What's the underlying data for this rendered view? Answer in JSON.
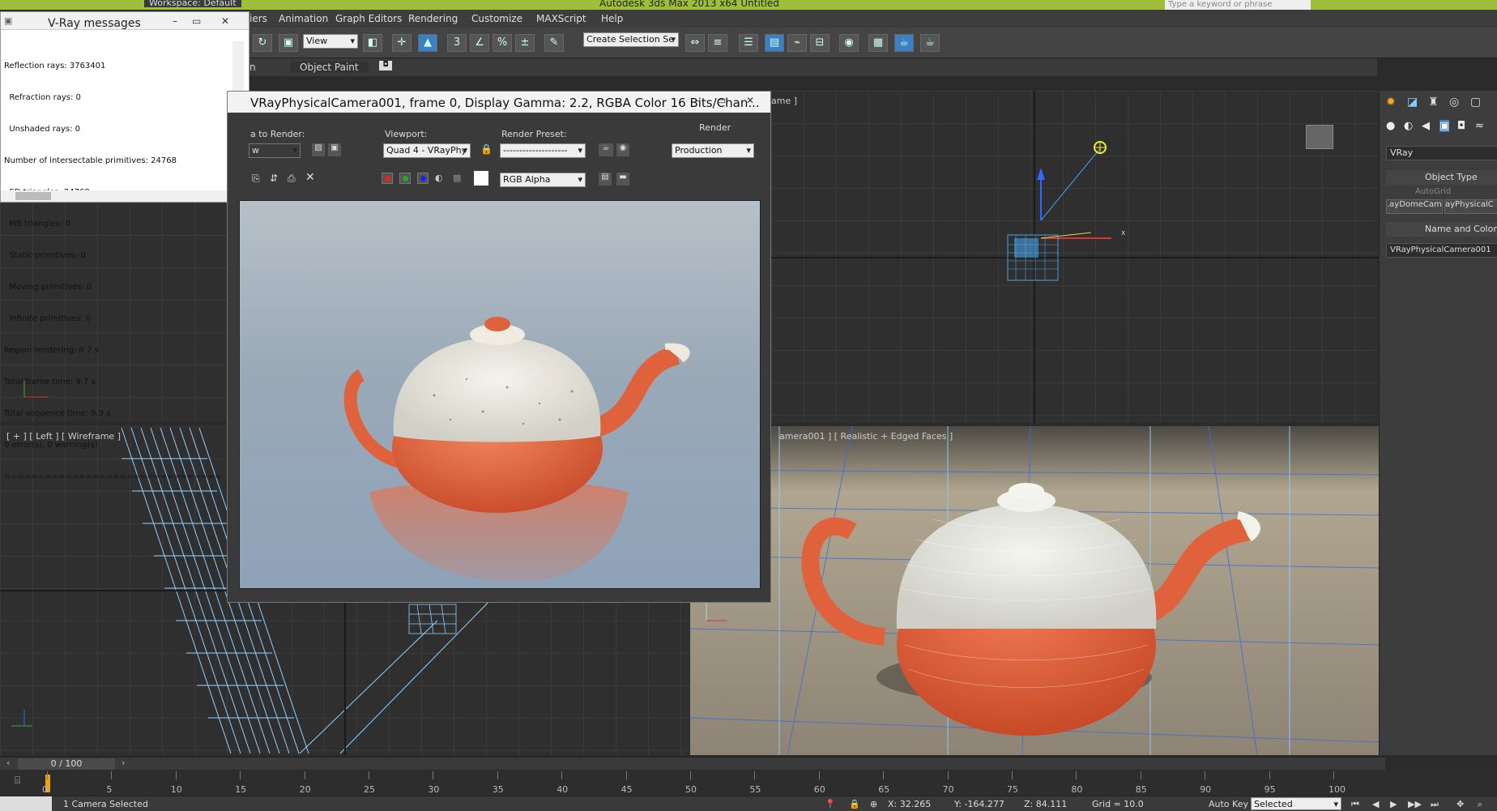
{
  "app": {
    "title": "Autodesk 3ds Max  2013 x64      Untitled",
    "workspace": "Workspace: Default",
    "search_placeholder": "Type a keyword or phrase"
  },
  "menu": [
    "iers",
    "Animation",
    "Graph Editors",
    "Rendering",
    "Customize",
    "MAXScript",
    "Help"
  ],
  "toolbar": {
    "view_dropdown": "View",
    "selection_set_placeholder": "Create Selection Se"
  },
  "ribbon": {
    "tab_partial": "n",
    "object_paint": "Object Paint"
  },
  "vray_messages": {
    "title": "V-Ray messages",
    "lines": [
      "Reflection rays: 3763401",
      "  Refraction rays: 0",
      "  Unshaded rays: 0",
      "Number of intersectable primitives: 24768",
      "  SD triangles: 24768",
      "  MB triangles: 0",
      "  Static primitives: 0",
      "  Moving primitives: 0",
      "  Infinite primitives: 0",
      "Region rendering: 9.7 s",
      "Total frame time: 9.7 s",
      "Total sequence time: 9.9 s",
      "0 error(s), 0 warning(s)",
      "================================"
    ]
  },
  "render_window": {
    "title": "VRayPhysicalCamera001, frame 0, Display Gamma: 2.2, RGBA Color 16 Bits/Chan...",
    "area_label": "a to Render:",
    "area_value": "w",
    "viewport_label": "Viewport:",
    "viewport_value": "Quad 4 - VRayPhy",
    "preset_label": "Render Preset:",
    "preset_value": "--------------------",
    "render_label": "Render",
    "render_value": "Production",
    "channel_value": "RGB Alpha"
  },
  "viewports": {
    "top_right_label": "ame ]",
    "left_label": "[ + ] [ Left ] [ Wireframe ]",
    "camera_label": "amera001 ] [ Realistic + Edged Faces ]"
  },
  "command_panel": {
    "renderer": "VRay",
    "object_type": "Object Type",
    "autogrid": "AutoGrid",
    "btn1": ".ayDomeCame",
    "btn2": "ayPhysicalC",
    "name_and_color": "Name and Color",
    "object_name": "VRayPhysicalCamera001"
  },
  "timeline": {
    "frame": "0 / 100",
    "ticks": [
      "0",
      "5",
      "10",
      "15",
      "20",
      "25",
      "30",
      "35",
      "40",
      "45",
      "50",
      "55",
      "60",
      "65",
      "70",
      "75",
      "80",
      "85",
      "90",
      "95",
      "100"
    ]
  },
  "status": {
    "selection": "1 Camera Selected",
    "x": "X: 32.265",
    "y": "Y: -164.277",
    "z": "Z: 84.111",
    "grid": "Grid = 10.0",
    "autokey": "Auto Key",
    "selected": "Selected"
  },
  "colors": {
    "title_green": "#9fbf3a",
    "teapot_orange": "#e0623d",
    "accent_blue": "#3b7fc4"
  }
}
